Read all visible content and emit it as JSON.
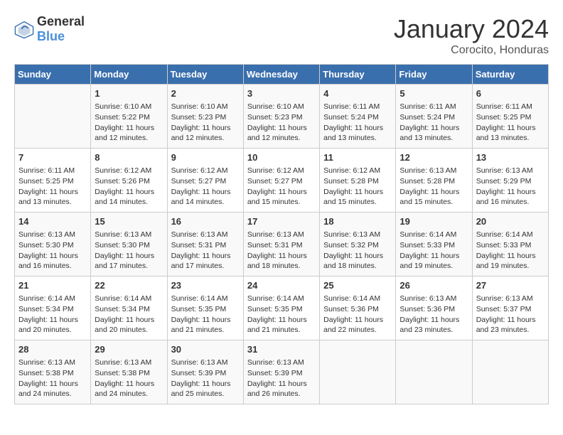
{
  "header": {
    "logo_general": "General",
    "logo_blue": "Blue",
    "month_year": "January 2024",
    "location": "Corocito, Honduras"
  },
  "days_of_week": [
    "Sunday",
    "Monday",
    "Tuesday",
    "Wednesday",
    "Thursday",
    "Friday",
    "Saturday"
  ],
  "weeks": [
    [
      {
        "day": "",
        "info": ""
      },
      {
        "day": "1",
        "info": "Sunrise: 6:10 AM\nSunset: 5:22 PM\nDaylight: 11 hours\nand 12 minutes."
      },
      {
        "day": "2",
        "info": "Sunrise: 6:10 AM\nSunset: 5:23 PM\nDaylight: 11 hours\nand 12 minutes."
      },
      {
        "day": "3",
        "info": "Sunrise: 6:10 AM\nSunset: 5:23 PM\nDaylight: 11 hours\nand 12 minutes."
      },
      {
        "day": "4",
        "info": "Sunrise: 6:11 AM\nSunset: 5:24 PM\nDaylight: 11 hours\nand 13 minutes."
      },
      {
        "day": "5",
        "info": "Sunrise: 6:11 AM\nSunset: 5:24 PM\nDaylight: 11 hours\nand 13 minutes."
      },
      {
        "day": "6",
        "info": "Sunrise: 6:11 AM\nSunset: 5:25 PM\nDaylight: 11 hours\nand 13 minutes."
      }
    ],
    [
      {
        "day": "7",
        "info": "Sunrise: 6:11 AM\nSunset: 5:25 PM\nDaylight: 11 hours\nand 13 minutes."
      },
      {
        "day": "8",
        "info": "Sunrise: 6:12 AM\nSunset: 5:26 PM\nDaylight: 11 hours\nand 14 minutes."
      },
      {
        "day": "9",
        "info": "Sunrise: 6:12 AM\nSunset: 5:27 PM\nDaylight: 11 hours\nand 14 minutes."
      },
      {
        "day": "10",
        "info": "Sunrise: 6:12 AM\nSunset: 5:27 PM\nDaylight: 11 hours\nand 15 minutes."
      },
      {
        "day": "11",
        "info": "Sunrise: 6:12 AM\nSunset: 5:28 PM\nDaylight: 11 hours\nand 15 minutes."
      },
      {
        "day": "12",
        "info": "Sunrise: 6:13 AM\nSunset: 5:28 PM\nDaylight: 11 hours\nand 15 minutes."
      },
      {
        "day": "13",
        "info": "Sunrise: 6:13 AM\nSunset: 5:29 PM\nDaylight: 11 hours\nand 16 minutes."
      }
    ],
    [
      {
        "day": "14",
        "info": "Sunrise: 6:13 AM\nSunset: 5:30 PM\nDaylight: 11 hours\nand 16 minutes."
      },
      {
        "day": "15",
        "info": "Sunrise: 6:13 AM\nSunset: 5:30 PM\nDaylight: 11 hours\nand 17 minutes."
      },
      {
        "day": "16",
        "info": "Sunrise: 6:13 AM\nSunset: 5:31 PM\nDaylight: 11 hours\nand 17 minutes."
      },
      {
        "day": "17",
        "info": "Sunrise: 6:13 AM\nSunset: 5:31 PM\nDaylight: 11 hours\nand 18 minutes."
      },
      {
        "day": "18",
        "info": "Sunrise: 6:13 AM\nSunset: 5:32 PM\nDaylight: 11 hours\nand 18 minutes."
      },
      {
        "day": "19",
        "info": "Sunrise: 6:14 AM\nSunset: 5:33 PM\nDaylight: 11 hours\nand 19 minutes."
      },
      {
        "day": "20",
        "info": "Sunrise: 6:14 AM\nSunset: 5:33 PM\nDaylight: 11 hours\nand 19 minutes."
      }
    ],
    [
      {
        "day": "21",
        "info": "Sunrise: 6:14 AM\nSunset: 5:34 PM\nDaylight: 11 hours\nand 20 minutes."
      },
      {
        "day": "22",
        "info": "Sunrise: 6:14 AM\nSunset: 5:34 PM\nDaylight: 11 hours\nand 20 minutes."
      },
      {
        "day": "23",
        "info": "Sunrise: 6:14 AM\nSunset: 5:35 PM\nDaylight: 11 hours\nand 21 minutes."
      },
      {
        "day": "24",
        "info": "Sunrise: 6:14 AM\nSunset: 5:35 PM\nDaylight: 11 hours\nand 21 minutes."
      },
      {
        "day": "25",
        "info": "Sunrise: 6:14 AM\nSunset: 5:36 PM\nDaylight: 11 hours\nand 22 minutes."
      },
      {
        "day": "26",
        "info": "Sunrise: 6:13 AM\nSunset: 5:36 PM\nDaylight: 11 hours\nand 23 minutes."
      },
      {
        "day": "27",
        "info": "Sunrise: 6:13 AM\nSunset: 5:37 PM\nDaylight: 11 hours\nand 23 minutes."
      }
    ],
    [
      {
        "day": "28",
        "info": "Sunrise: 6:13 AM\nSunset: 5:38 PM\nDaylight: 11 hours\nand 24 minutes."
      },
      {
        "day": "29",
        "info": "Sunrise: 6:13 AM\nSunset: 5:38 PM\nDaylight: 11 hours\nand 24 minutes."
      },
      {
        "day": "30",
        "info": "Sunrise: 6:13 AM\nSunset: 5:39 PM\nDaylight: 11 hours\nand 25 minutes."
      },
      {
        "day": "31",
        "info": "Sunrise: 6:13 AM\nSunset: 5:39 PM\nDaylight: 11 hours\nand 26 minutes."
      },
      {
        "day": "",
        "info": ""
      },
      {
        "day": "",
        "info": ""
      },
      {
        "day": "",
        "info": ""
      }
    ]
  ]
}
